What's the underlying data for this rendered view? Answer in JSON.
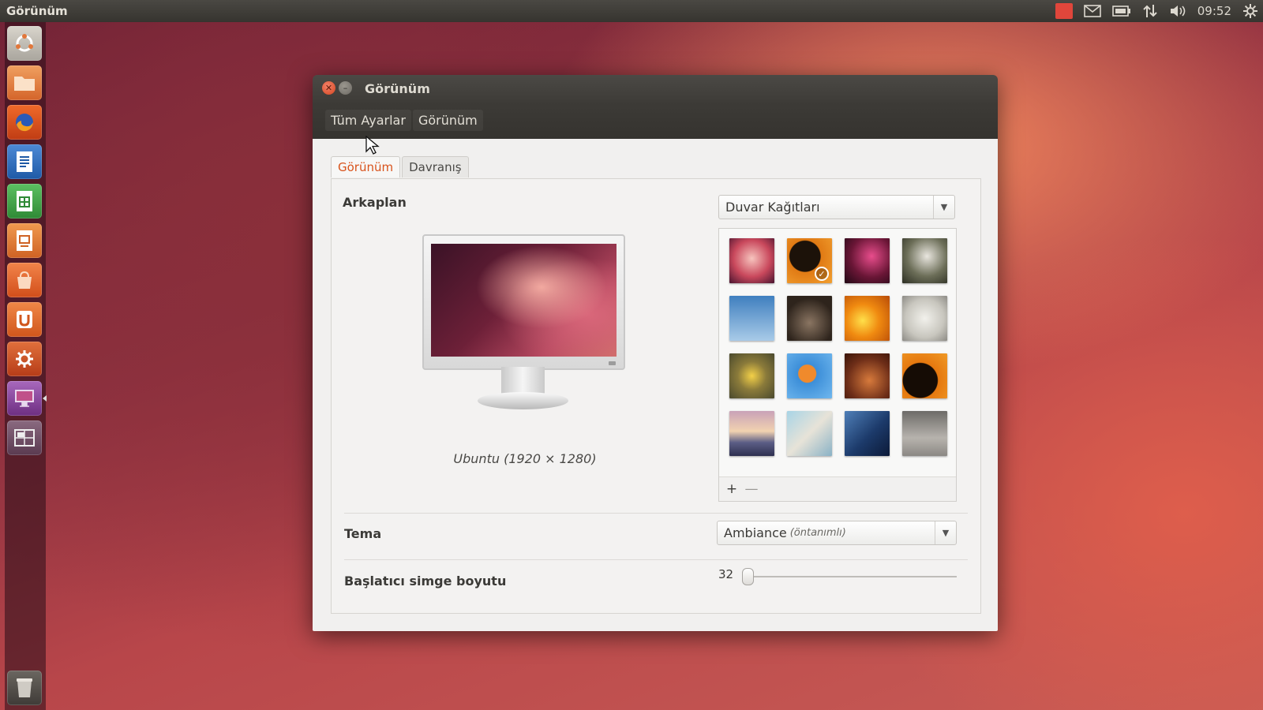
{
  "topbar": {
    "app_title": "Görünüm",
    "clock": "09:52",
    "indicators": [
      "mail-icon",
      "battery-icon",
      "network-icon",
      "volume-icon",
      "session-gear-icon"
    ]
  },
  "launcher": {
    "items": [
      {
        "name": "dash-home",
        "icon": "ubuntu-logo",
        "color": "#c9c5bd"
      },
      {
        "name": "files",
        "icon": "folder",
        "color": "#e2773a"
      },
      {
        "name": "firefox",
        "icon": "browser",
        "color": "#e25a1c"
      },
      {
        "name": "libreoffice-writer",
        "icon": "document",
        "color": "#2f6fbf"
      },
      {
        "name": "libreoffice-calc",
        "icon": "spreadsheet",
        "color": "#3fa046"
      },
      {
        "name": "libreoffice-impress",
        "icon": "presentation",
        "color": "#e2773a"
      },
      {
        "name": "software-center",
        "icon": "shopping-bag",
        "color": "#e86c2c"
      },
      {
        "name": "ubuntu-one",
        "icon": "u-logo",
        "color": "#e2773a"
      },
      {
        "name": "system-settings",
        "icon": "wrench-gear",
        "color": "#d9532a"
      },
      {
        "name": "appearance",
        "icon": "monitor",
        "color": "#8d4aa0"
      },
      {
        "name": "workspace-switcher",
        "icon": "workspaces",
        "color": "#6b4a60"
      }
    ],
    "trash": "trash-icon"
  },
  "window": {
    "title": "Görünüm",
    "breadcrumb": [
      "Tüm Ayarlar",
      "Görünüm"
    ],
    "tabs": [
      {
        "label": "Görünüm",
        "active": true
      },
      {
        "label": "Davranış",
        "active": false
      }
    ],
    "background": {
      "label": "Arkaplan",
      "preview_caption": "Ubuntu (1920 × 1280)",
      "source_combo": "Duvar Kağıtları",
      "add_label": "+",
      "remove_label": "—",
      "wallpapers": [
        {
          "name": "ubuntu-warty-red",
          "bg": "radial-gradient(circle at 50% 45%,#f7c4be,#c9485c 55%,#4a1530)",
          "selected": false
        },
        {
          "name": "orange-vinyl",
          "bg": "radial-gradient(circle at 40% 40%,#1c1209 40%,#e07a14 42%,#f2a030)",
          "selected": true
        },
        {
          "name": "purple-swirl",
          "bg": "radial-gradient(circle at 60% 40%,#e84d8c,#6a1636 55%,#200814)",
          "selected": false
        },
        {
          "name": "white-blossoms",
          "bg": "radial-gradient(circle at 55% 40%,#e9e6df,#6c6e58 55%,#2c2e22)",
          "selected": false
        },
        {
          "name": "blue-sky-twigs",
          "bg": "linear-gradient(#3f7fbf,#a9cbe8)",
          "selected": false
        },
        {
          "name": "dark-rain",
          "bg": "radial-gradient(circle at 50% 60%,#8a7562,#2e241c 70%)",
          "selected": false
        },
        {
          "name": "orange-flower",
          "bg": "radial-gradient(circle at 40% 55%,#ffe04a,#f08a10 45%,#b84b08)",
          "selected": false
        },
        {
          "name": "clock-face",
          "bg": "radial-gradient(circle at 50% 50%,#f2f1ec,#c8c6be 60%,#8d8b85)",
          "selected": false
        },
        {
          "name": "yellow-flower",
          "bg": "radial-gradient(circle at 50% 50%,#f3d048,#8a7a3a 45%,#4b4a2e)",
          "selected": false
        },
        {
          "name": "cartoon-fish",
          "bg": "radial-gradient(circle at 45% 45%,#f08a2c 25%,#3c8ed8 27%,#6fb7ee)",
          "selected": false
        },
        {
          "name": "brown-lizard",
          "bg": "radial-gradient(circle at 55% 60%,#d77a3c,#6e2e18 60%,#3a1408)",
          "selected": false
        },
        {
          "name": "orange-ring",
          "bg": "radial-gradient(circle at 40% 60%,#150c05 45%,#e5780f 47%,#f09a26)",
          "selected": false
        },
        {
          "name": "sunset-sky",
          "bg": "linear-gradient(#c9a2b8,#f1d2b0 45%,#5c5e86 70%,#2e3050)",
          "selected": false
        },
        {
          "name": "bird-branch",
          "bg": "linear-gradient(135deg,#a8d4e6,#e7e3d8 50%,#8ab2c6)",
          "selected": false
        },
        {
          "name": "blue-water",
          "bg": "linear-gradient(135deg,#4f7fb8,#1c3a6a 55%,#0c1a38)",
          "selected": false
        },
        {
          "name": "grey-rain",
          "bg": "linear-gradient(#6d6b68,#b7b3ad 60%,#8b8884)",
          "selected": false
        }
      ]
    },
    "theme": {
      "label": "Tema",
      "value": "Ambiance",
      "value_note": "(öntanımlı)"
    },
    "launcher_icon_size": {
      "label": "Başlatıcı simge boyutu",
      "value": "32",
      "fraction": 0.0
    }
  }
}
